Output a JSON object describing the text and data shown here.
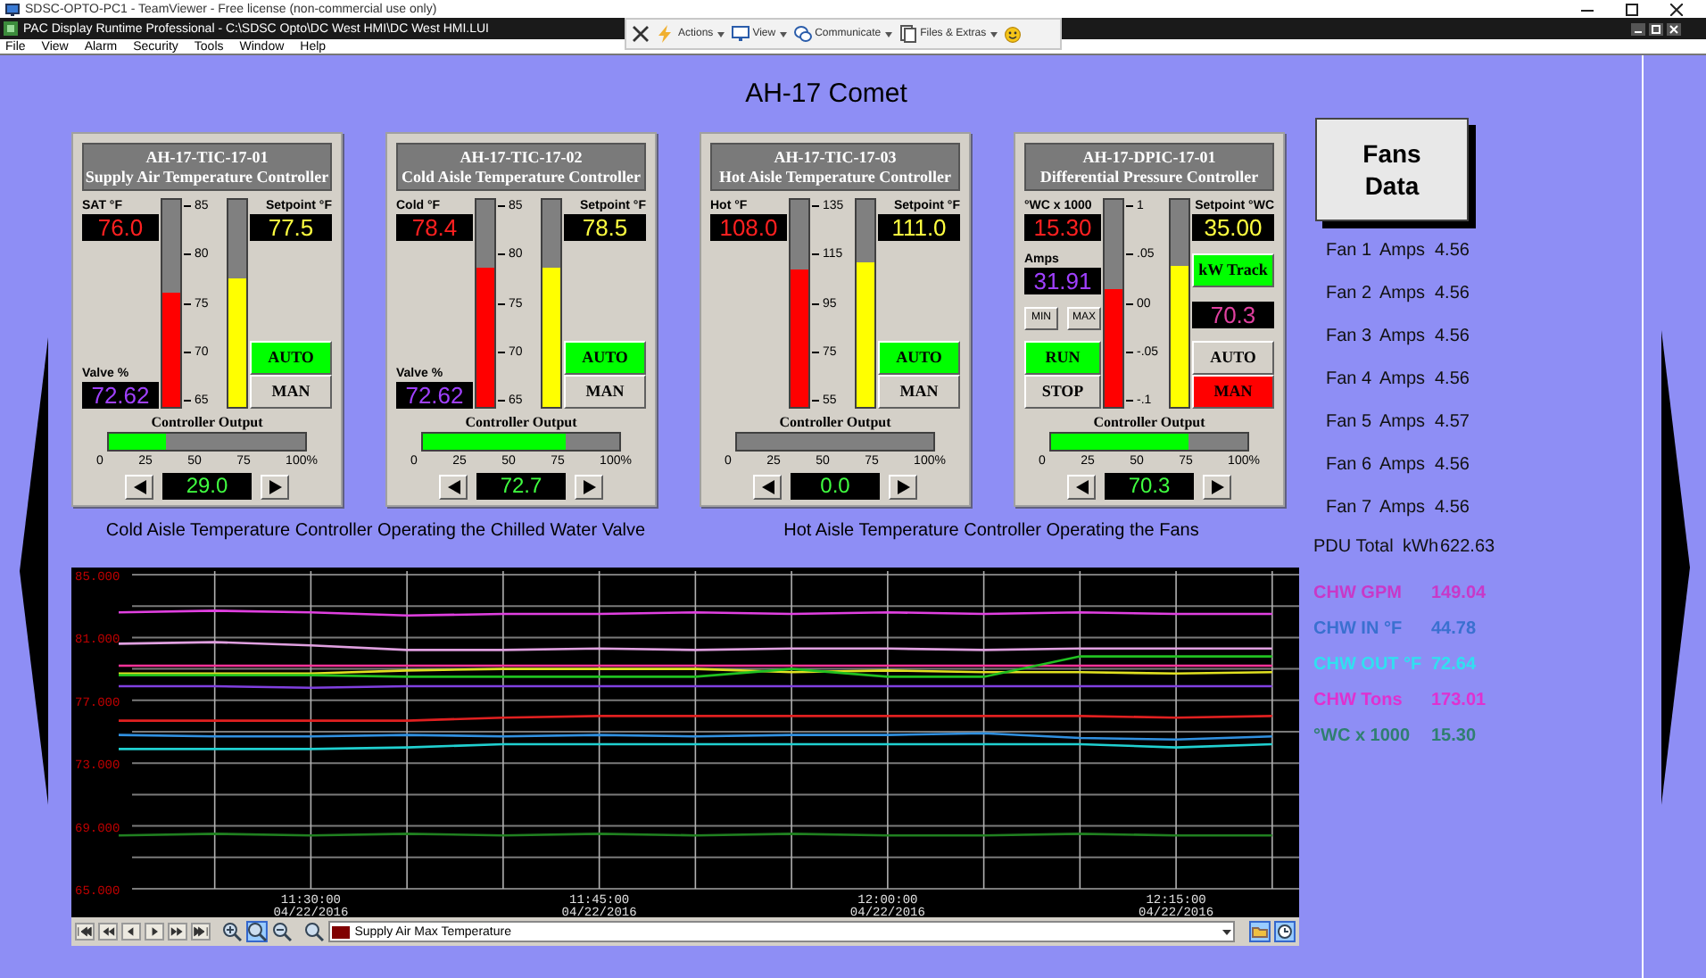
{
  "teamviewer": {
    "title": "SDSC-OPTO-PC1 - TeamViewer - Free license (non-commercial use only)",
    "toolbar": [
      {
        "kind": "actions",
        "label": "Actions"
      },
      {
        "kind": "view",
        "label": "View"
      },
      {
        "kind": "communicate",
        "label": "Communicate"
      },
      {
        "kind": "files",
        "label": "Files & Extras"
      }
    ]
  },
  "app": {
    "title": "PAC Display Runtime Professional - C:\\SDSC Opto\\DC West HMI\\DC West HMI.LUI",
    "menu": [
      "File",
      "View",
      "Alarm",
      "Security",
      "Tools",
      "Window",
      "Help"
    ]
  },
  "screen": {
    "title": "AH-17 Comet",
    "controllers": [
      {
        "tag": "AH-17-TIC-17-01",
        "title": "Supply Air Temperature Controller",
        "left": [
          {
            "kind": "process_readout",
            "label": "SAT °F",
            "value": "76.0"
          },
          {
            "kind": "aux_readout",
            "label": "Valve %",
            "value": "72.62"
          }
        ],
        "gauge": {
          "scale": [
            "85",
            "80",
            "75",
            "70",
            "65"
          ],
          "process": {
            "level": 0.55
          },
          "setpoint": {
            "level": 0.625
          }
        },
        "right": [
          {
            "kind": "setpoint_readout",
            "label": "Setpoint °F",
            "value": "77.5"
          },
          {
            "kind": "buttons",
            "buttons": [
              {
                "label": "AUTO",
                "on": true,
                "color": "#00ff00"
              },
              {
                "label": "MAN",
                "on": false
              }
            ]
          }
        ],
        "output": {
          "label": "Controller Output",
          "level": 0.29,
          "ticks": [
            "0",
            "25",
            "50",
            "75",
            "100%"
          ],
          "value": "29.0"
        }
      },
      {
        "tag": "AH-17-TIC-17-02",
        "title": "Cold Aisle Temperature Controller",
        "left": [
          {
            "kind": "process_readout",
            "label": "Cold °F",
            "value": "78.4"
          },
          {
            "kind": "aux_readout",
            "label": "Valve %",
            "value": "72.62"
          }
        ],
        "gauge": {
          "scale": [
            "85",
            "80",
            "75",
            "70",
            "65"
          ],
          "process": {
            "level": 0.67
          },
          "setpoint": {
            "level": 0.675
          }
        },
        "right": [
          {
            "kind": "setpoint_readout",
            "label": "Setpoint °F",
            "value": "78.5"
          },
          {
            "kind": "buttons",
            "buttons": [
              {
                "label": "AUTO",
                "on": true,
                "color": "#00ff00"
              },
              {
                "label": "MAN",
                "on": false
              }
            ]
          }
        ],
        "output": {
          "label": "Controller Output",
          "level": 0.727,
          "ticks": [
            "0",
            "25",
            "50",
            "75",
            "100%"
          ],
          "value": "72.7"
        }
      },
      {
        "tag": "AH-17-TIC-17-03",
        "title": "Hot Aisle Temperature Controller",
        "left": [
          {
            "kind": "process_readout",
            "label": "Hot °F",
            "value": "108.0"
          }
        ],
        "gauge": {
          "scale": [
            "135",
            "115",
            "95",
            "75",
            "55"
          ],
          "process": {
            "level": 0.66
          },
          "setpoint": {
            "level": 0.7
          }
        },
        "right": [
          {
            "kind": "setpoint_readout",
            "label": "Setpoint °F",
            "value": "111.0"
          },
          {
            "kind": "buttons",
            "buttons": [
              {
                "label": "AUTO",
                "on": true,
                "color": "#00ff00"
              },
              {
                "label": "MAN",
                "on": false
              }
            ]
          }
        ],
        "output": {
          "label": "Controller Output",
          "level": 0.0,
          "ticks": [
            "0",
            "25",
            "50",
            "75",
            "100%"
          ],
          "value": "0.0"
        }
      },
      {
        "tag": "AH-17-DPIC-17-01",
        "title": "Differential Pressure Controller",
        "left": [
          {
            "kind": "process_readout",
            "label": "°WC x 1000",
            "value": "15.30"
          },
          {
            "kind": "aux_readout",
            "label": "Amps",
            "value": "31.91"
          },
          {
            "kind": "small_buttons",
            "labels": [
              "MIN",
              "MAX"
            ]
          },
          {
            "kind": "buttons",
            "buttons": [
              {
                "label": "RUN",
                "on": true,
                "color": "#00ff00"
              },
              {
                "label": "STOP",
                "on": false
              }
            ]
          }
        ],
        "gauge": {
          "scale": [
            "1",
            ".05",
            "00",
            "-.05",
            "-.1"
          ],
          "process": {
            "level": 0.57
          },
          "setpoint": {
            "level": 0.68
          }
        },
        "right": [
          {
            "kind": "setpoint_readout",
            "label": "Setpoint °WC",
            "value": "35.00"
          },
          {
            "kind": "buttons",
            "buttons": [
              {
                "label": "kW Track",
                "on": true,
                "color": "#00ff00"
              }
            ]
          },
          {
            "kind": "track_readout",
            "value": "70.3"
          },
          {
            "kind": "buttons",
            "buttons": [
              {
                "label": "AUTO",
                "on": false
              },
              {
                "label": "MAN",
                "on": true,
                "color": "#ff0000"
              }
            ]
          }
        ],
        "output": {
          "label": "Controller Output",
          "level": 0.703,
          "ticks": [
            "0",
            "25",
            "50",
            "75",
            "100%"
          ],
          "value": "70.3"
        }
      }
    ],
    "captions": [
      "Cold Aisle Temperature Controller Operating the Chilled Water Valve",
      "Hot Aisle Temperature Controller Operating the Fans"
    ],
    "chart": {
      "chart_data": {
        "type": "line",
        "grid": true,
        "categories": [
          null,
          null,
          "11:30:00 04/22/2016",
          null,
          null,
          "11:45:00 04/22/2016",
          null,
          null,
          "12:00:00 04/22/2016",
          null,
          null,
          "12:15:00 04/22/2016",
          null
        ],
        "ylim": [
          65,
          85
        ],
        "yticks": [
          {
            "value": 85,
            "label": "85.000"
          },
          {
            "value": 81,
            "label": "81.000"
          },
          {
            "value": 77,
            "label": "77.000"
          },
          {
            "value": 73,
            "label": "73.000"
          },
          {
            "value": 69,
            "label": "69.000"
          },
          {
            "value": 65,
            "label": "65.000"
          }
        ],
        "series": [
          {
            "color": "#e040e0",
            "values": [
              82.6,
              82.7,
              82.6,
              82.4,
              82.5,
              82.5,
              82.6,
              82.5,
              82.6,
              82.5,
              82.6,
              82.5,
              82.5
            ]
          },
          {
            "color": "#e0a0e0",
            "values": [
              80.6,
              80.7,
              80.5,
              80.2,
              80.2,
              80.3,
              80.2,
              80.3,
              80.3,
              80.2,
              80.3,
              80.3,
              80.3
            ]
          },
          {
            "color": "#ff3399",
            "values": [
              79.2,
              79.2,
              79.2,
              79.2,
              79.2,
              79.2,
              79.2,
              79.2,
              79.2,
              79.2,
              79.2,
              79.2,
              79.2
            ]
          },
          {
            "color": "#e0e020",
            "values": [
              78.7,
              78.7,
              78.7,
              78.9,
              79.0,
              79.0,
              79.0,
              78.8,
              78.9,
              78.8,
              78.8,
              78.7,
              78.8
            ]
          },
          {
            "color": "#20c020",
            "values": [
              78.6,
              78.6,
              78.6,
              78.5,
              78.5,
              78.5,
              78.5,
              79.0,
              78.5,
              78.5,
              79.8,
              79.8,
              79.8
            ]
          },
          {
            "color": "#8040e0",
            "values": [
              77.9,
              77.9,
              77.8,
              77.9,
              77.9,
              77.9,
              77.9,
              77.9,
              77.9,
              77.9,
              77.9,
              77.9,
              77.9
            ]
          },
          {
            "color": "#e02020",
            "values": [
              75.7,
              75.7,
              75.7,
              75.7,
              75.9,
              76.0,
              76.0,
              76.0,
              76.0,
              76.0,
              76.0,
              75.9,
              76.0
            ]
          },
          {
            "color": "#3090e0",
            "values": [
              74.8,
              74.7,
              74.7,
              74.8,
              74.7,
              74.8,
              74.7,
              74.8,
              74.8,
              74.9,
              74.6,
              74.5,
              74.7
            ]
          },
          {
            "color": "#20d0d0",
            "values": [
              73.9,
              73.9,
              73.9,
              74.0,
              74.2,
              74.2,
              74.2,
              74.2,
              74.2,
              74.2,
              74.2,
              74.0,
              74.2
            ]
          },
          {
            "color": "#208020",
            "values": [
              68.4,
              68.5,
              68.4,
              68.5,
              68.4,
              68.5,
              68.4,
              68.5,
              68.4,
              68.4,
              68.5,
              68.4,
              68.4
            ]
          }
        ]
      },
      "pen_select": {
        "value": "Supply Air Max Temperature",
        "color": "#800000"
      }
    },
    "fans_button": "Fans Data",
    "fans": [
      {
        "label": "Fan 1",
        "unit": "Amps",
        "value": "4.56"
      },
      {
        "label": "Fan 2",
        "unit": "Amps",
        "value": "4.56"
      },
      {
        "label": "Fan 3",
        "unit": "Amps",
        "value": "4.56"
      },
      {
        "label": "Fan 4",
        "unit": "Amps",
        "value": "4.56"
      },
      {
        "label": "Fan 5",
        "unit": "Amps",
        "value": "4.57"
      },
      {
        "label": "Fan 6",
        "unit": "Amps",
        "value": "4.56"
      },
      {
        "label": "Fan 7",
        "unit": "Amps",
        "value": "4.56"
      }
    ],
    "pdu": {
      "label": "PDU Total",
      "unit": "kWh",
      "value": "622.63"
    },
    "chw": [
      {
        "label": "CHW GPM",
        "value": "149.04",
        "color": "#c838c8"
      },
      {
        "label": "CHW IN °F",
        "value": "44.78",
        "color": "#3a70d0"
      },
      {
        "label": "CHW OUT °F",
        "value": "72.64",
        "color": "#30e0f0"
      },
      {
        "label": "CHW Tons",
        "value": "173.01",
        "color": "#e030d0"
      },
      {
        "label": "°WC x 1000",
        "value": "15.30",
        "color": "#2f7f70"
      }
    ]
  }
}
